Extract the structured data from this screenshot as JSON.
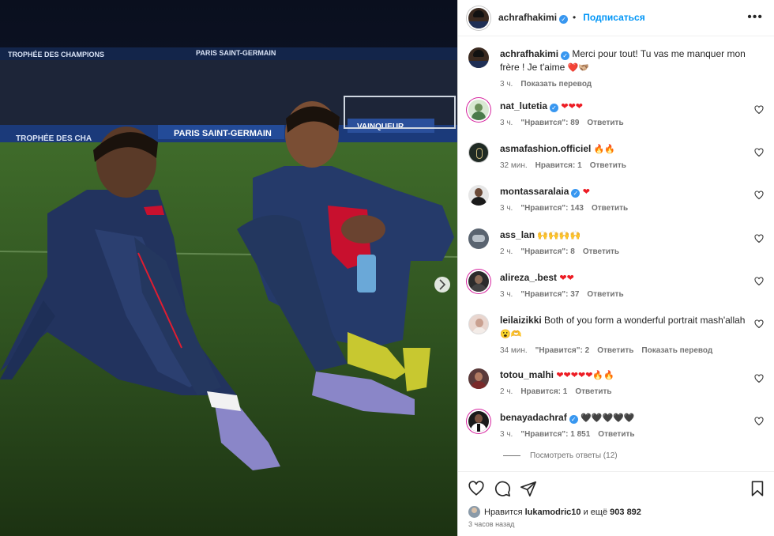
{
  "photo": {
    "description_alt": "",
    "banner_texts": [
      "TROPHÉE DES CHAMPIONS",
      "PARIS SAINT-GERMAIN",
      "PARIS SAINT-GERMAIN",
      "TROPHÉE DES CHA",
      "VAINQUEUR"
    ]
  },
  "header": {
    "username": "achrafhakimi",
    "follow_label": "Подписаться",
    "more_label": "•••"
  },
  "caption": {
    "username": "achrafhakimi",
    "text": "Merci pour tout! Tu vas me manquer mon frère ! Je t'aime",
    "emoji": "❤️🫱🏼‍🫲🏽",
    "time": "3 ч.",
    "translate": "Показать перевод"
  },
  "comments": [
    {
      "username": "nat_lutetia",
      "verified": true,
      "text": "",
      "emoji": "❤❤❤",
      "time": "3 ч.",
      "likes": "\"Нравится\": 89",
      "reply": "Ответить",
      "translate": ""
    },
    {
      "username": "asmafashion.officiel",
      "verified": false,
      "text": "",
      "emoji": "🔥🔥",
      "time": "32 мин.",
      "likes": "Нравится: 1",
      "reply": "Ответить",
      "translate": ""
    },
    {
      "username": "montassaralaia",
      "verified": true,
      "text": "",
      "emoji": "❤",
      "time": "3 ч.",
      "likes": "\"Нравится\": 143",
      "reply": "Ответить",
      "translate": ""
    },
    {
      "username": "ass_lan",
      "verified": false,
      "text": "",
      "emoji": "🙌🙌🙌🙌",
      "time": "2 ч.",
      "likes": "\"Нравится\": 8",
      "reply": "Ответить",
      "translate": ""
    },
    {
      "username": "alireza_.best",
      "verified": false,
      "text": "",
      "emoji": "❤❤",
      "time": "3 ч.",
      "likes": "\"Нравится\": 37",
      "reply": "Ответить",
      "translate": ""
    },
    {
      "username": "leilaizikki",
      "verified": false,
      "text": "Both of you form a wonderful portrait mash'allah",
      "emoji": "😮🫶",
      "time": "34 мин.",
      "likes": "\"Нравится\": 2",
      "reply": "Ответить",
      "translate": "Показать перевод"
    },
    {
      "username": "totou_malhi",
      "verified": false,
      "text": "",
      "emoji": "❤❤❤❤❤🔥🔥",
      "time": "2 ч.",
      "likes": "Нравится: 1",
      "reply": "Ответить",
      "translate": ""
    },
    {
      "username": "benayadachraf",
      "verified": true,
      "text": "",
      "emoji": "🖤🖤🖤🖤🖤",
      "time": "3 ч.",
      "likes": "\"Нравится\": 1 851",
      "reply": "Ответить",
      "translate": ""
    }
  ],
  "view_replies": "Посмотреть ответы (12)",
  "footer": {
    "liked_prefix": "Нравится",
    "liked_user": "lukamodric10",
    "liked_suffix": "и ещё",
    "liked_count": "903 892",
    "time": "3 часов назад"
  },
  "icons": {
    "like": "heart-icon",
    "comment": "comment-icon",
    "share": "share-icon",
    "save": "bookmark-icon",
    "next": "chevron-right-icon"
  },
  "colors": {
    "accent": "#0095f6",
    "verified": "#3897f0",
    "heart": "#ed1c24",
    "muted": "#737373"
  }
}
